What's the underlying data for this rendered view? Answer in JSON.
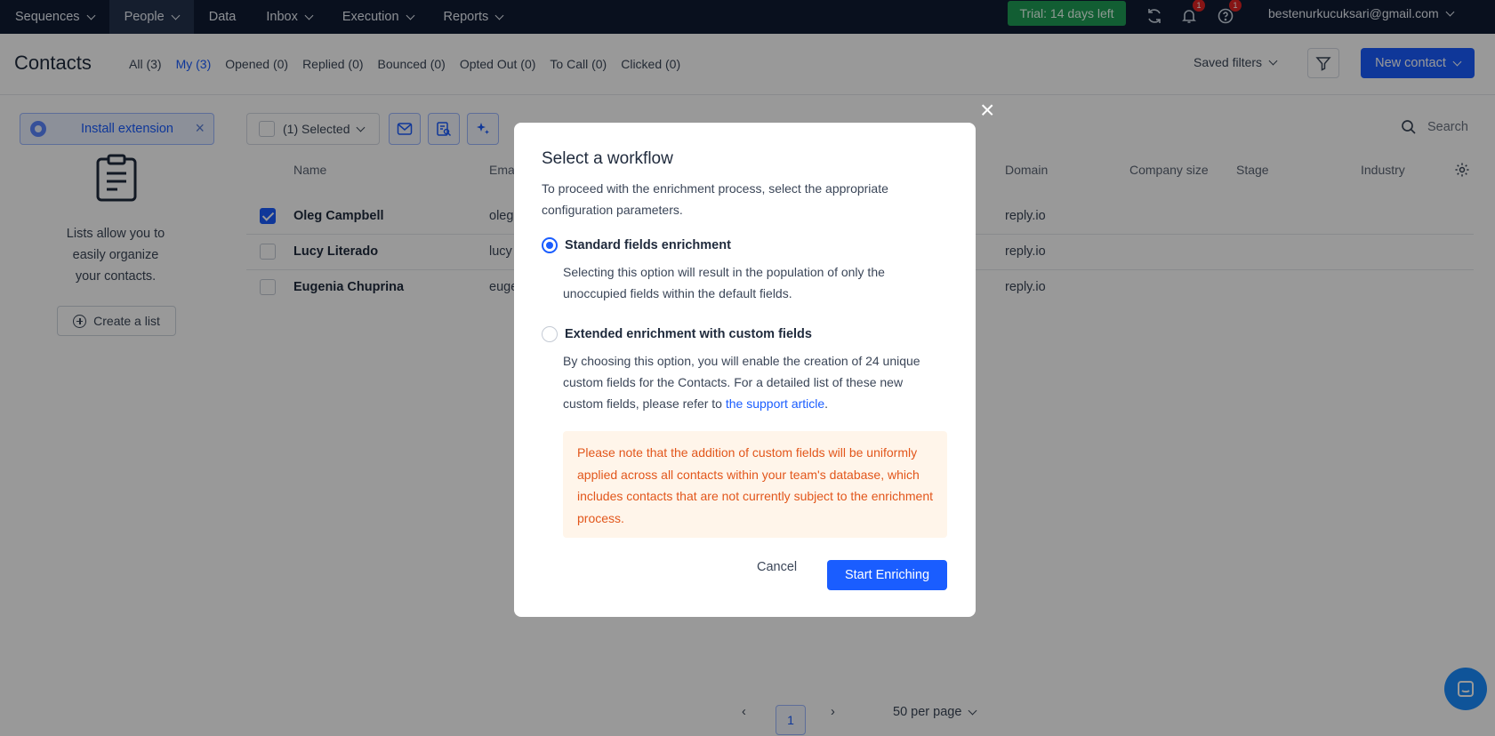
{
  "nav": {
    "items": [
      {
        "label": "Sequences",
        "has_menu": true
      },
      {
        "label": "People",
        "has_menu": true,
        "active": true
      },
      {
        "label": "Data",
        "has_menu": false
      },
      {
        "label": "Inbox",
        "has_menu": true
      },
      {
        "label": "Execution",
        "has_menu": true
      },
      {
        "label": "Reports",
        "has_menu": true
      }
    ],
    "trial_label": "Trial: 14 days left",
    "notifications_count": "1",
    "help_count": "1",
    "account_email": "bestenurkucuksari@gmail.com"
  },
  "page": {
    "title": "Contacts",
    "filters": [
      {
        "label": "All (3)",
        "active": false
      },
      {
        "label": "My (3)",
        "active": true
      },
      {
        "label": "Opened (0)",
        "active": false
      },
      {
        "label": "Replied (0)",
        "active": false
      },
      {
        "label": "Bounced (0)",
        "active": false
      },
      {
        "label": "Opted Out (0)",
        "active": false
      },
      {
        "label": "To Call (0)",
        "active": false
      },
      {
        "label": "Clicked (0)",
        "active": false
      }
    ],
    "saved_filters_label": "Saved filters",
    "new_contact_label": "New contact"
  },
  "sidebar": {
    "install_extension_label": "Install extension",
    "lists_text_1": "Lists allow you to",
    "lists_text_2": "easily organize",
    "lists_text_3": "your contacts.",
    "create_list_label": "Create a list"
  },
  "toolbar": {
    "selected_label": "(1) Selected",
    "search_placeholder": "Search"
  },
  "table": {
    "headers": {
      "name": "Name",
      "email": "Ema",
      "domain": "Domain",
      "company_size": "Company size",
      "stage": "Stage",
      "industry": "Industry"
    },
    "rows": [
      {
        "name": "Oleg Campbell",
        "email": "oleg",
        "domain": "reply.io",
        "checked": true
      },
      {
        "name": "Lucy Literado",
        "email": "lucy",
        "domain": "reply.io",
        "checked": false
      },
      {
        "name": "Eugenia Chuprina",
        "email": "euge",
        "domain": "reply.io",
        "checked": false
      }
    ]
  },
  "pagination": {
    "current_page": "1",
    "per_page_label": "50 per page"
  },
  "modal": {
    "title": "Select a workflow",
    "description": "To proceed with the enrichment process, select the appropriate configuration parameters.",
    "option_standard_label": "Standard fields enrichment",
    "option_standard_desc": "Selecting this option will result in the population of only the unoccupied fields within the default fields.",
    "option_extended_label": "Extended enrichment with custom fields",
    "option_extended_desc": "By choosing this option, you will enable the creation of 24 unique custom fields for the Contacts. For a detailed list of these new custom fields, please refer to ",
    "support_link": "the support article",
    "period": ".",
    "note": "Please note that the addition of custom fields will be uniformly applied across all contacts within your team's database, which includes contacts that are not currently subject to the enrichment process.",
    "cancel_label": "Cancel",
    "start_label": "Start Enriching",
    "selected_option": "standard"
  },
  "colors": {
    "accent": "#1a5dff",
    "nav_bg": "#0f1b33",
    "trial_bg": "#1f9d55",
    "note_text": "#e2561b",
    "note_bg": "#fff5ea"
  }
}
